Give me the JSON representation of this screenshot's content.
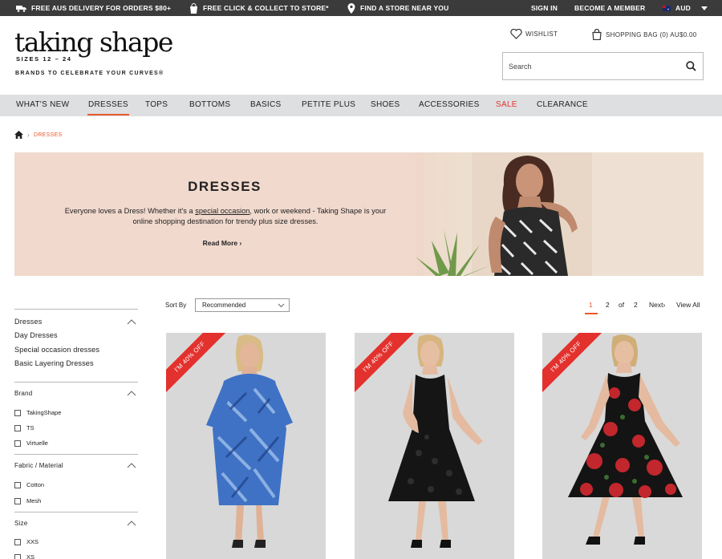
{
  "topbar": {
    "delivery": "FREE AUS DELIVERY FOR ORDERS $80+",
    "click_collect": "FREE CLICK & COLLECT TO STORE*",
    "find_store": "FIND A STORE NEAR YOU",
    "sign_in": "SIGN IN",
    "become_member": "BECOME A MEMBER",
    "currency": "AUD"
  },
  "brand": {
    "logo": "taking shape",
    "sizes": "SIZES 12 – 24",
    "tagline": "BRANDS TO CELEBRATE YOUR CURVES®"
  },
  "header": {
    "wishlist": "WISHLIST",
    "bag": "SHOPPING BAG (0) AU$0.00",
    "search_placeholder": "Search"
  },
  "nav": [
    "WHAT'S NEW",
    "DRESSES",
    "TOPS",
    "BOTTOMS",
    "BASICS",
    "PETITE PLUS",
    "SHOES",
    "ACCESSORIES",
    "SALE",
    "CLEARANCE"
  ],
  "breadcrumb": {
    "current": "DRESSES"
  },
  "banner": {
    "title": "DRESSES",
    "desc_before": "Everyone loves a Dress! Whether it's a ",
    "desc_link": "special occasion",
    "desc_after": ", work or weekend - Taking Shape is your online shopping destination for trendy plus size dresses.",
    "read_more": "Read More ›"
  },
  "filters": {
    "category": {
      "heading": "Dresses",
      "links": [
        "Day Dresses",
        "Special occasion dresses",
        "Basic Layering Dresses"
      ]
    },
    "brand": {
      "heading": "Brand",
      "options": [
        "TakingShape",
        "TS",
        "Virtuelle"
      ]
    },
    "fabric": {
      "heading": "Fabric / Material",
      "options": [
        "Cotton",
        "Mesh"
      ]
    },
    "size": {
      "heading": "Size",
      "options": [
        "XXS",
        "XS"
      ]
    }
  },
  "sort": {
    "label": "Sort By",
    "selected": "Recommended"
  },
  "pagination": {
    "current": "1",
    "next_page": "2",
    "of": "of",
    "total": "2",
    "next": "Next›",
    "view_all": "View All"
  },
  "products": [
    {
      "badge": "I'M 40% OFF"
    },
    {
      "badge": "I'M 40% OFF"
    },
    {
      "badge": "I'M 40% OFF"
    }
  ],
  "colors": {
    "accent": "#e8592b",
    "sale": "#e3312d",
    "topbar": "#3b3b3b",
    "nav": "#dedfe1",
    "banner": "#f1d9cd"
  }
}
